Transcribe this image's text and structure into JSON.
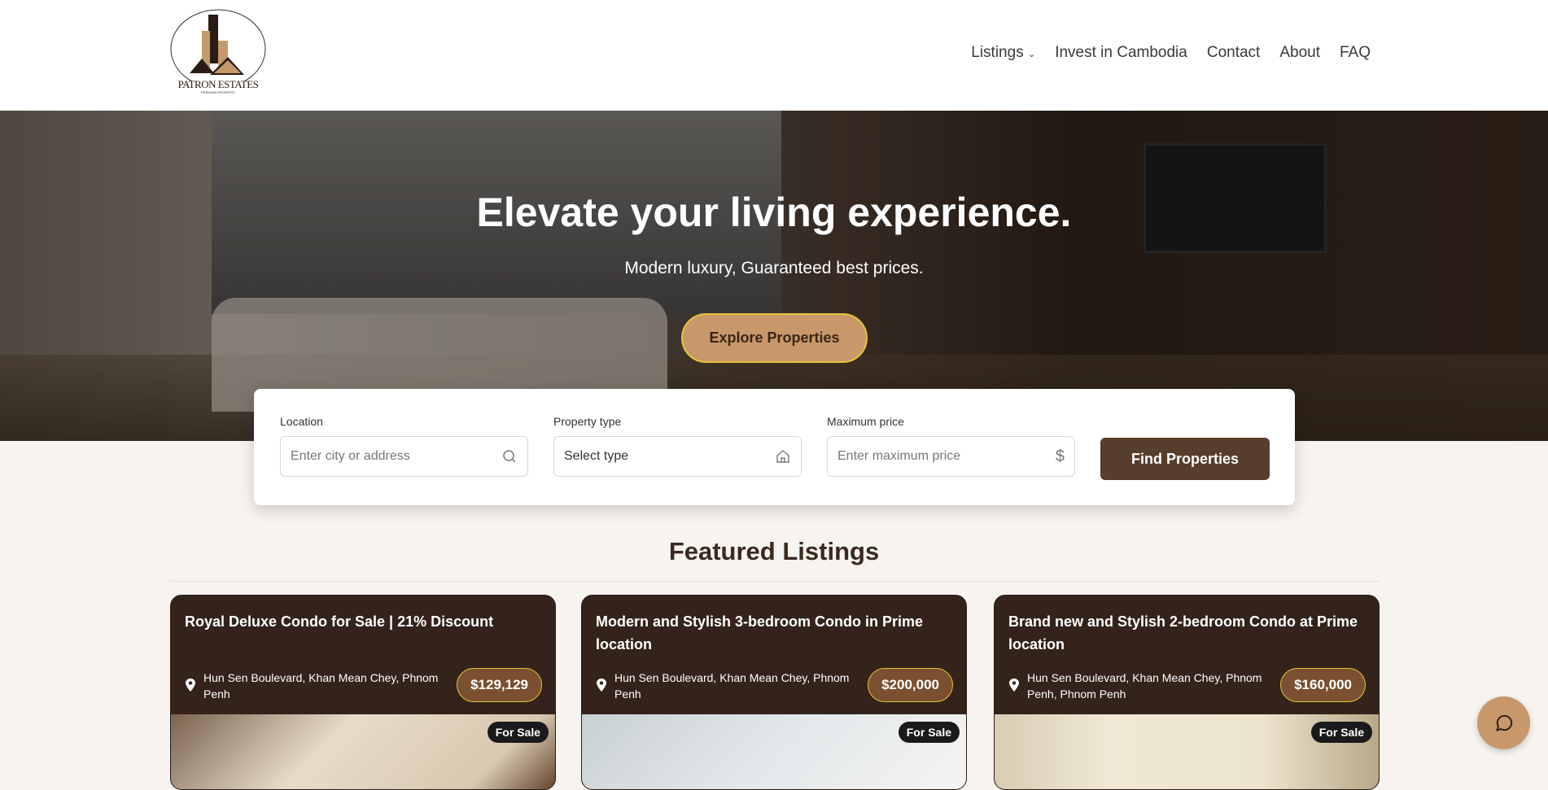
{
  "brand": {
    "name": "PATRON ESTATES",
    "tagline": "PREMIUM PROPERTY"
  },
  "nav": [
    {
      "label": "Listings",
      "has_dropdown": true
    },
    {
      "label": "Invest in Cambodia"
    },
    {
      "label": "Contact"
    },
    {
      "label": "About"
    },
    {
      "label": "FAQ"
    }
  ],
  "hero": {
    "title": "Elevate your living experience.",
    "subtitle": "Modern luxury, Guaranteed best prices.",
    "cta": "Explore Properties"
  },
  "search": {
    "location": {
      "label": "Location",
      "placeholder": "Enter city or address",
      "icon": "search-icon"
    },
    "type": {
      "label": "Property type",
      "value": "Select type",
      "icon": "home-icon"
    },
    "price": {
      "label": "Maximum price",
      "placeholder": "Enter maximum price",
      "icon": "dollar-icon"
    },
    "submit": "Find Properties"
  },
  "featured": {
    "title": "Featured Listings",
    "listings": [
      {
        "title": "Royal Deluxe Condo for Sale | 21% Discount",
        "location": "Hun Sen Boulevard, Khan Mean Chey, Phnom Penh",
        "price": "$129,129",
        "badge": "For Sale"
      },
      {
        "title": "Modern and Stylish 3-bedroom Condo in Prime location",
        "location": "Hun Sen Boulevard, Khan Mean Chey, Phnom Penh",
        "price": "$200,000",
        "badge": "For Sale"
      },
      {
        "title": "Brand new and Stylish 2-bedroom Condo at Prime location",
        "location": "Hun Sen Boulevard, Khan Mean Chey, Phnom Penh, Phnom Penh",
        "price": "$160,000",
        "badge": "For Sale"
      }
    ]
  },
  "colors": {
    "accent": "#c9986a",
    "dark_brown": "#33231a",
    "button": "#573d2b",
    "price_border": "#e6c23a"
  }
}
